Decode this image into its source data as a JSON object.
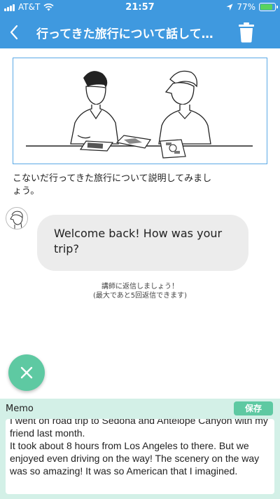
{
  "status_bar": {
    "carrier": "AT&T",
    "time": "21:57",
    "battery": "77%",
    "battery_level": 0.77,
    "icons": [
      "signal-icon",
      "wifi-icon",
      "location-icon",
      "battery-icon"
    ]
  },
  "nav": {
    "title": "行ってきた旅行について話して…",
    "back_icon": "back-chevron-icon",
    "delete_icon": "trash-icon"
  },
  "lesson": {
    "instruction": "こないだ行ってきた旅行について説明してみましょう。"
  },
  "chat": {
    "teacher_message": "Welcome back! How was your trip?",
    "reply_note_line1": "講師に返信しましょう！",
    "reply_note_line2": "(最大であと5回返信できます)"
  },
  "memo": {
    "label": "Memo",
    "save_label": "保存",
    "content": "I went on road trip to Sedona and Antelope Canyon with my friend last month.\nIt took about 8 hours from Los Angeles to there. But we enjoyed even driving on the way! The scenery on the way was so amazing! It was so American that I imagined."
  },
  "colors": {
    "header_blue": "#3f99df",
    "accent_green": "#5ec9a2",
    "memo_background": "#d3f0e7",
    "bubble_gray": "#ececec"
  }
}
